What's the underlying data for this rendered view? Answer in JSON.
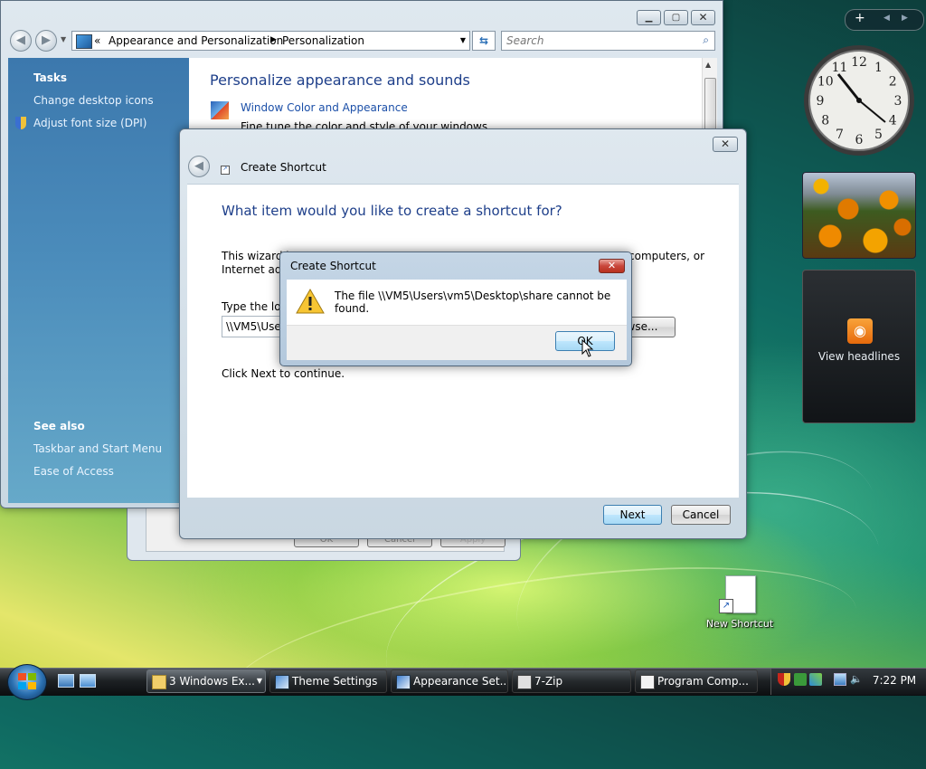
{
  "desktop": {
    "icon_label": "New Shortcut"
  },
  "personalization_window": {
    "breadcrumb": [
      "Appearance and Personalization",
      "Personalization"
    ],
    "breadcrumb_prefix": "«",
    "search_placeholder": "Search",
    "sidebar": {
      "tasks_heading": "Tasks",
      "tasks": [
        "Change desktop icons",
        "Adjust font size (DPI)"
      ],
      "see_also_heading": "See also",
      "see_also": [
        "Taskbar and Start Menu",
        "Ease of Access"
      ]
    },
    "main_heading": "Personalize appearance and sounds",
    "items": [
      {
        "title": "Window Color and Appearance",
        "description": "Fine tune the color and style of your windows"
      }
    ]
  },
  "background_window": {
    "buttons": [
      "OK",
      "Cancel",
      "Apply"
    ]
  },
  "wizard": {
    "title": "Create Shortcut",
    "heading": "What item would you like to create a shortcut for?",
    "intro_left": "This wizard h",
    "intro_right": "computers, or",
    "intro_line2": "Internet add",
    "location_label": "Type the loc",
    "location_value": "\\\\VM5\\Use",
    "browse_label": "wse...",
    "continue_text": "Click Next to continue.",
    "next_label": "Next",
    "cancel_label": "Cancel"
  },
  "error_dialog": {
    "title": "Create Shortcut",
    "message": "The file \\\\VM5\\Users\\vm5\\Desktop\\share cannot be found.",
    "ok_label": "OK"
  },
  "gadgets": {
    "clock_numbers": [
      "12",
      "1",
      "2",
      "3",
      "4",
      "5",
      "6",
      "7",
      "8",
      "9",
      "10",
      "11"
    ],
    "feed_label": "View headlines"
  },
  "taskbar": {
    "buttons": [
      {
        "label": "3 Windows Ex...",
        "icon": "folder-icon"
      },
      {
        "label": "Theme Settings",
        "icon": "theme-icon"
      },
      {
        "label": "Appearance Set...",
        "icon": "appearance-icon"
      },
      {
        "label": "7-Zip",
        "icon": "archive-icon"
      },
      {
        "label": "Program Comp...",
        "icon": "program-icon"
      }
    ],
    "clock": "7:22 PM"
  },
  "colors": {
    "link": "#1b4fa8",
    "heading": "#1e3f8a",
    "sidebar": "#3f7fb3"
  }
}
